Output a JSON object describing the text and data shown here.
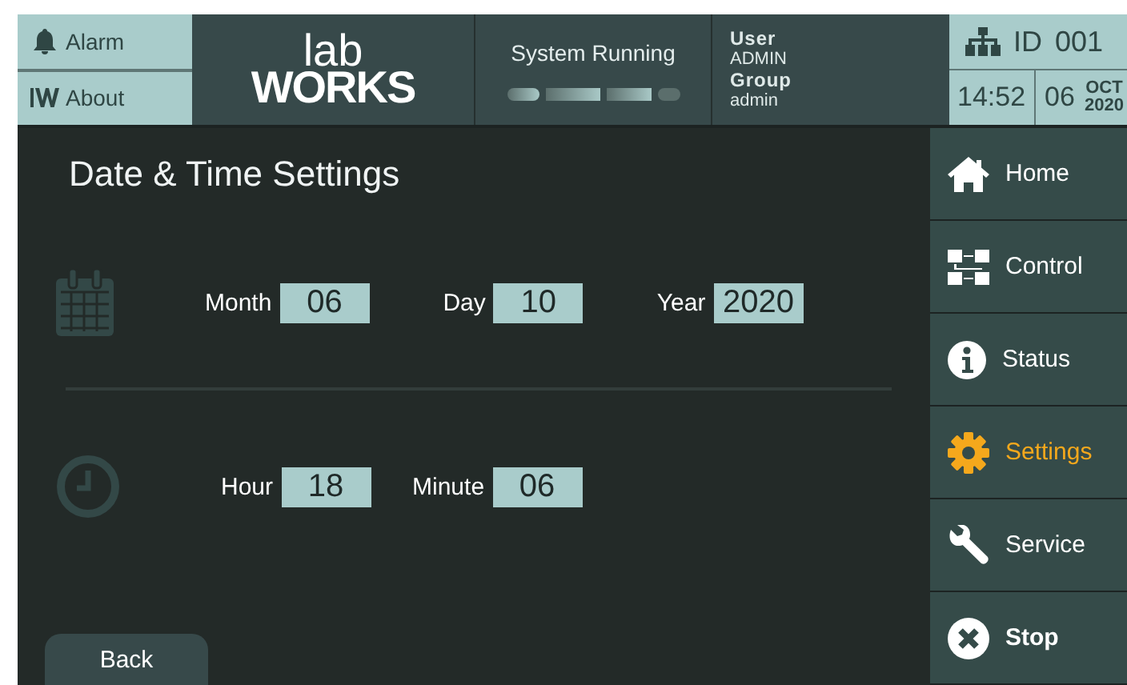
{
  "header": {
    "alarm": "Alarm",
    "about": "About",
    "logo_top": "lab",
    "logo_bottom": "WORKS",
    "system_status": "System Running",
    "user_label": "User",
    "user": "ADMIN",
    "group_label": "Group",
    "group": "admin",
    "id_label": "ID",
    "id": "001",
    "time": "14:52",
    "day": "06",
    "month": "OCT",
    "year": "2020"
  },
  "title": "Date & Time Settings",
  "date_fields": [
    {
      "label": "Month",
      "value": "06"
    },
    {
      "label": "Day",
      "value": "10"
    },
    {
      "label": "Year",
      "value": "2020"
    }
  ],
  "time_fields": [
    {
      "label": "Hour",
      "value": "18"
    },
    {
      "label": "Minute",
      "value": "06"
    }
  ],
  "back": "Back",
  "nav": [
    {
      "label": "Home",
      "selected": false,
      "kind": "nav"
    },
    {
      "label": "Control",
      "selected": false,
      "kind": "nav"
    },
    {
      "label": "Status",
      "selected": false,
      "kind": "nav"
    },
    {
      "label": "Settings",
      "selected": true,
      "kind": "nav"
    },
    {
      "label": "Service",
      "selected": false,
      "kind": "nav"
    },
    {
      "label": "Stop",
      "selected": false,
      "kind": "stop"
    }
  ]
}
